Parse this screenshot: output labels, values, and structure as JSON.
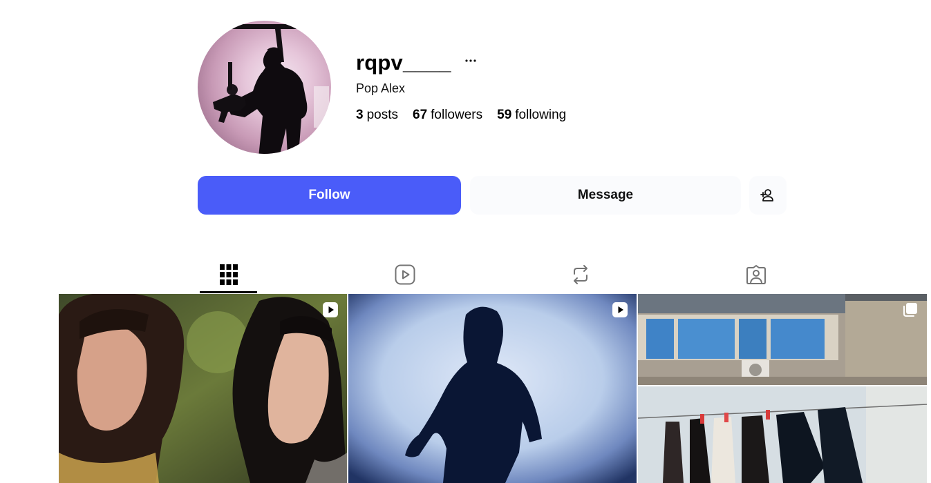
{
  "profile": {
    "username": "rqpv____",
    "display_name": "Pop Alex",
    "more_icon": "more-horizontal-icon",
    "stats": [
      {
        "value": "3",
        "label": "posts"
      },
      {
        "value": "67",
        "label": "followers"
      },
      {
        "value": "59",
        "label": "following"
      }
    ]
  },
  "actions": {
    "follow_label": "Follow",
    "message_label": "Message",
    "add_user_icon": "person-add-icon"
  },
  "tabs": [
    {
      "icon": "grid-icon",
      "active": true
    },
    {
      "icon": "reels-icon",
      "active": false
    },
    {
      "icon": "repost-icon",
      "active": false
    },
    {
      "icon": "tagged-icon",
      "active": false
    }
  ],
  "posts": [
    {
      "type": "video",
      "badge_icon": "video-badge-icon"
    },
    {
      "type": "video",
      "badge_icon": "video-badge-icon"
    },
    {
      "type": "carousel",
      "badge_icon": "carousel-badge-icon"
    }
  ],
  "colors": {
    "follow_bg": "#4a5cf9",
    "secondary_bg": "#fafbfd"
  }
}
